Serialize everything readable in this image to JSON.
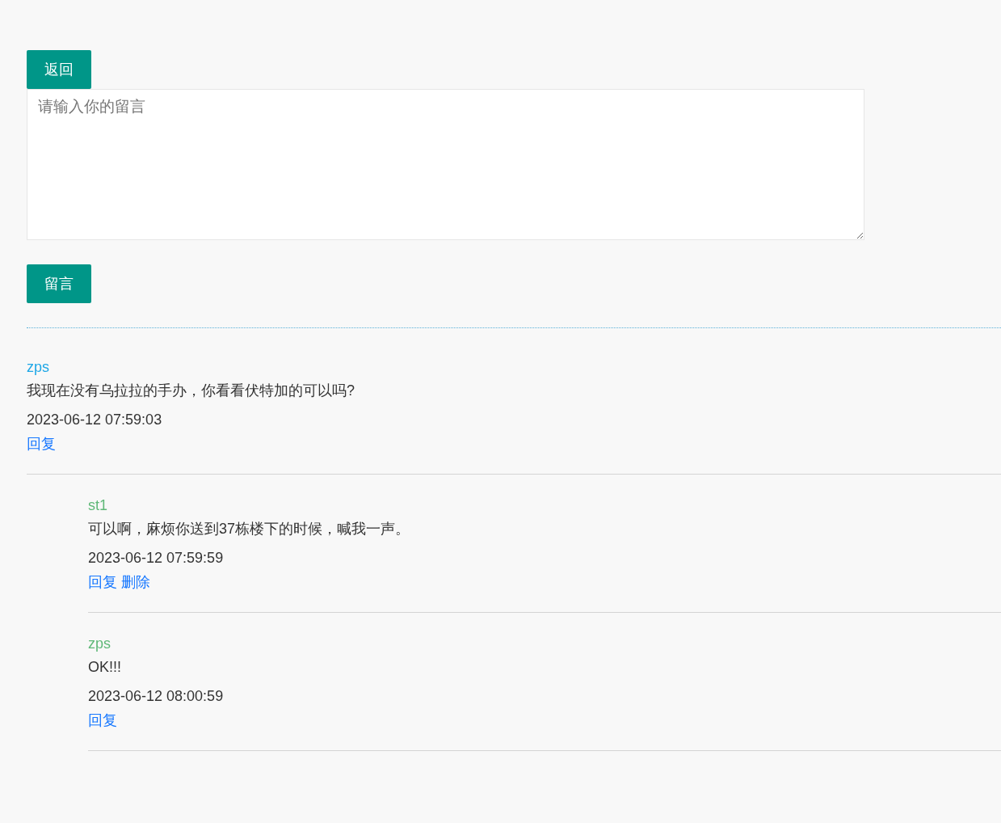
{
  "back_button": "返回",
  "message_box": {
    "placeholder": "请输入你的留言"
  },
  "submit_button": "留言",
  "comments": [
    {
      "author": "zps",
      "text": "我现在没有乌拉拉的手办，你看看伏特加的可以吗?",
      "time": "2023-06-12 07:59:03",
      "actions": [
        "回复"
      ],
      "children": [
        {
          "author": "st1",
          "text": "可以啊，麻烦你送到37栋楼下的时候，喊我一声。",
          "time": "2023-06-12 07:59:59",
          "actions": [
            "回复",
            "删除"
          ]
        },
        {
          "author": "zps",
          "text": "OK!!!",
          "time": "2023-06-12 08:00:59",
          "actions": [
            "回复"
          ]
        }
      ]
    }
  ]
}
